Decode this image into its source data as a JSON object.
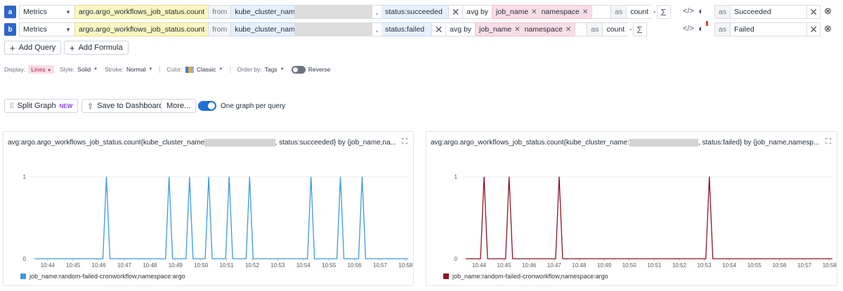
{
  "queries": [
    {
      "letter": "a",
      "source": "Metrics",
      "metric": "argo.argo_workflows_job_status.count",
      "from_label": "from",
      "tag1": "kube_cluster_name",
      "comma": ",",
      "tag2": "status:succeeded",
      "agg_label": "avg by",
      "group_tags": [
        "job_name",
        "namespace"
      ],
      "as_label": "as",
      "as_value": "count",
      "alias_as": "as",
      "alias": "Succeeded"
    },
    {
      "letter": "b",
      "source": "Metrics",
      "metric": "argo.argo_workflows_job_status.count",
      "from_label": "from",
      "tag1": "kube_cluster_name",
      "comma": ",",
      "tag2": "status:failed",
      "agg_label": "avg by",
      "group_tags": [
        "job_name",
        "namespace"
      ],
      "as_label": "as",
      "as_value": "count",
      "alias_as": "as",
      "alias": "Failed"
    }
  ],
  "buttons": {
    "add_query": "Add Query",
    "add_formula": "Add Formula",
    "split_graph": "Split Graph",
    "split_badge": "NEW",
    "save_dashboard": "Save to Dashboard",
    "more": "More...",
    "one_graph": "One graph per query"
  },
  "options": {
    "display_label": "Display:",
    "display_value": "Lines",
    "style_label": "Style:",
    "style_value": "Solid",
    "stroke_label": "Stroke:",
    "stroke_value": "Normal",
    "color_label": "Color:",
    "color_value": "Classic",
    "order_label": "Order by:",
    "order_value": "Tags",
    "reverse_label": "Reverse"
  },
  "colors": {
    "accent": "#2c67c9",
    "series_a": "#3d9ae0",
    "series_b": "#8b1427"
  },
  "chart_data": [
    {
      "type": "line",
      "title_prefix": "avg:argo.argo_workflows_job_status.count{kube_cluster_name",
      "title_suffix": ", status:succeeded} by {job_name,na...",
      "yticks": [
        "0",
        "1"
      ],
      "ylim": [
        0,
        1
      ],
      "xticks": [
        "10:44",
        "10:45",
        "10:46",
        "10:47",
        "10:48",
        "10:49",
        "10:50",
        "10:51",
        "10:52",
        "10:53",
        "10:54",
        "10:55",
        "10:56",
        "10:57",
        "10:58"
      ],
      "xlim": [
        10.68,
        15.1
      ],
      "spike_minutes": [
        46.3,
        48.75,
        49.55,
        50.3,
        51.1,
        51.9,
        54.3,
        55.45,
        56.3
      ],
      "series": [
        {
          "name": "job_name:random-failed-cronworkflow,namespace:argo",
          "color": "#3d9ae0"
        }
      ]
    },
    {
      "type": "line",
      "title_prefix": "avg:argo.argo_workflows_job_status.count{kube_cluster_name:",
      "title_suffix": ", status:failed} by {job_name,namesp...",
      "yticks": [
        "0",
        "1"
      ],
      "ylim": [
        0,
        1
      ],
      "xticks": [
        "10:44",
        "10:45",
        "10:46",
        "10:47",
        "10:48",
        "10:49",
        "10:50",
        "10:51",
        "10:52",
        "10:53",
        "10:54",
        "10:55",
        "10:56",
        "10:57",
        "10:58"
      ],
      "xlim": [
        10.66,
        15.12
      ],
      "spike_minutes": [
        44.2,
        45.2,
        47.2,
        53.2
      ],
      "series": [
        {
          "name": "job_name:random-failed-cronworkflow,namespace:argo",
          "color": "#8b1427"
        }
      ]
    }
  ]
}
